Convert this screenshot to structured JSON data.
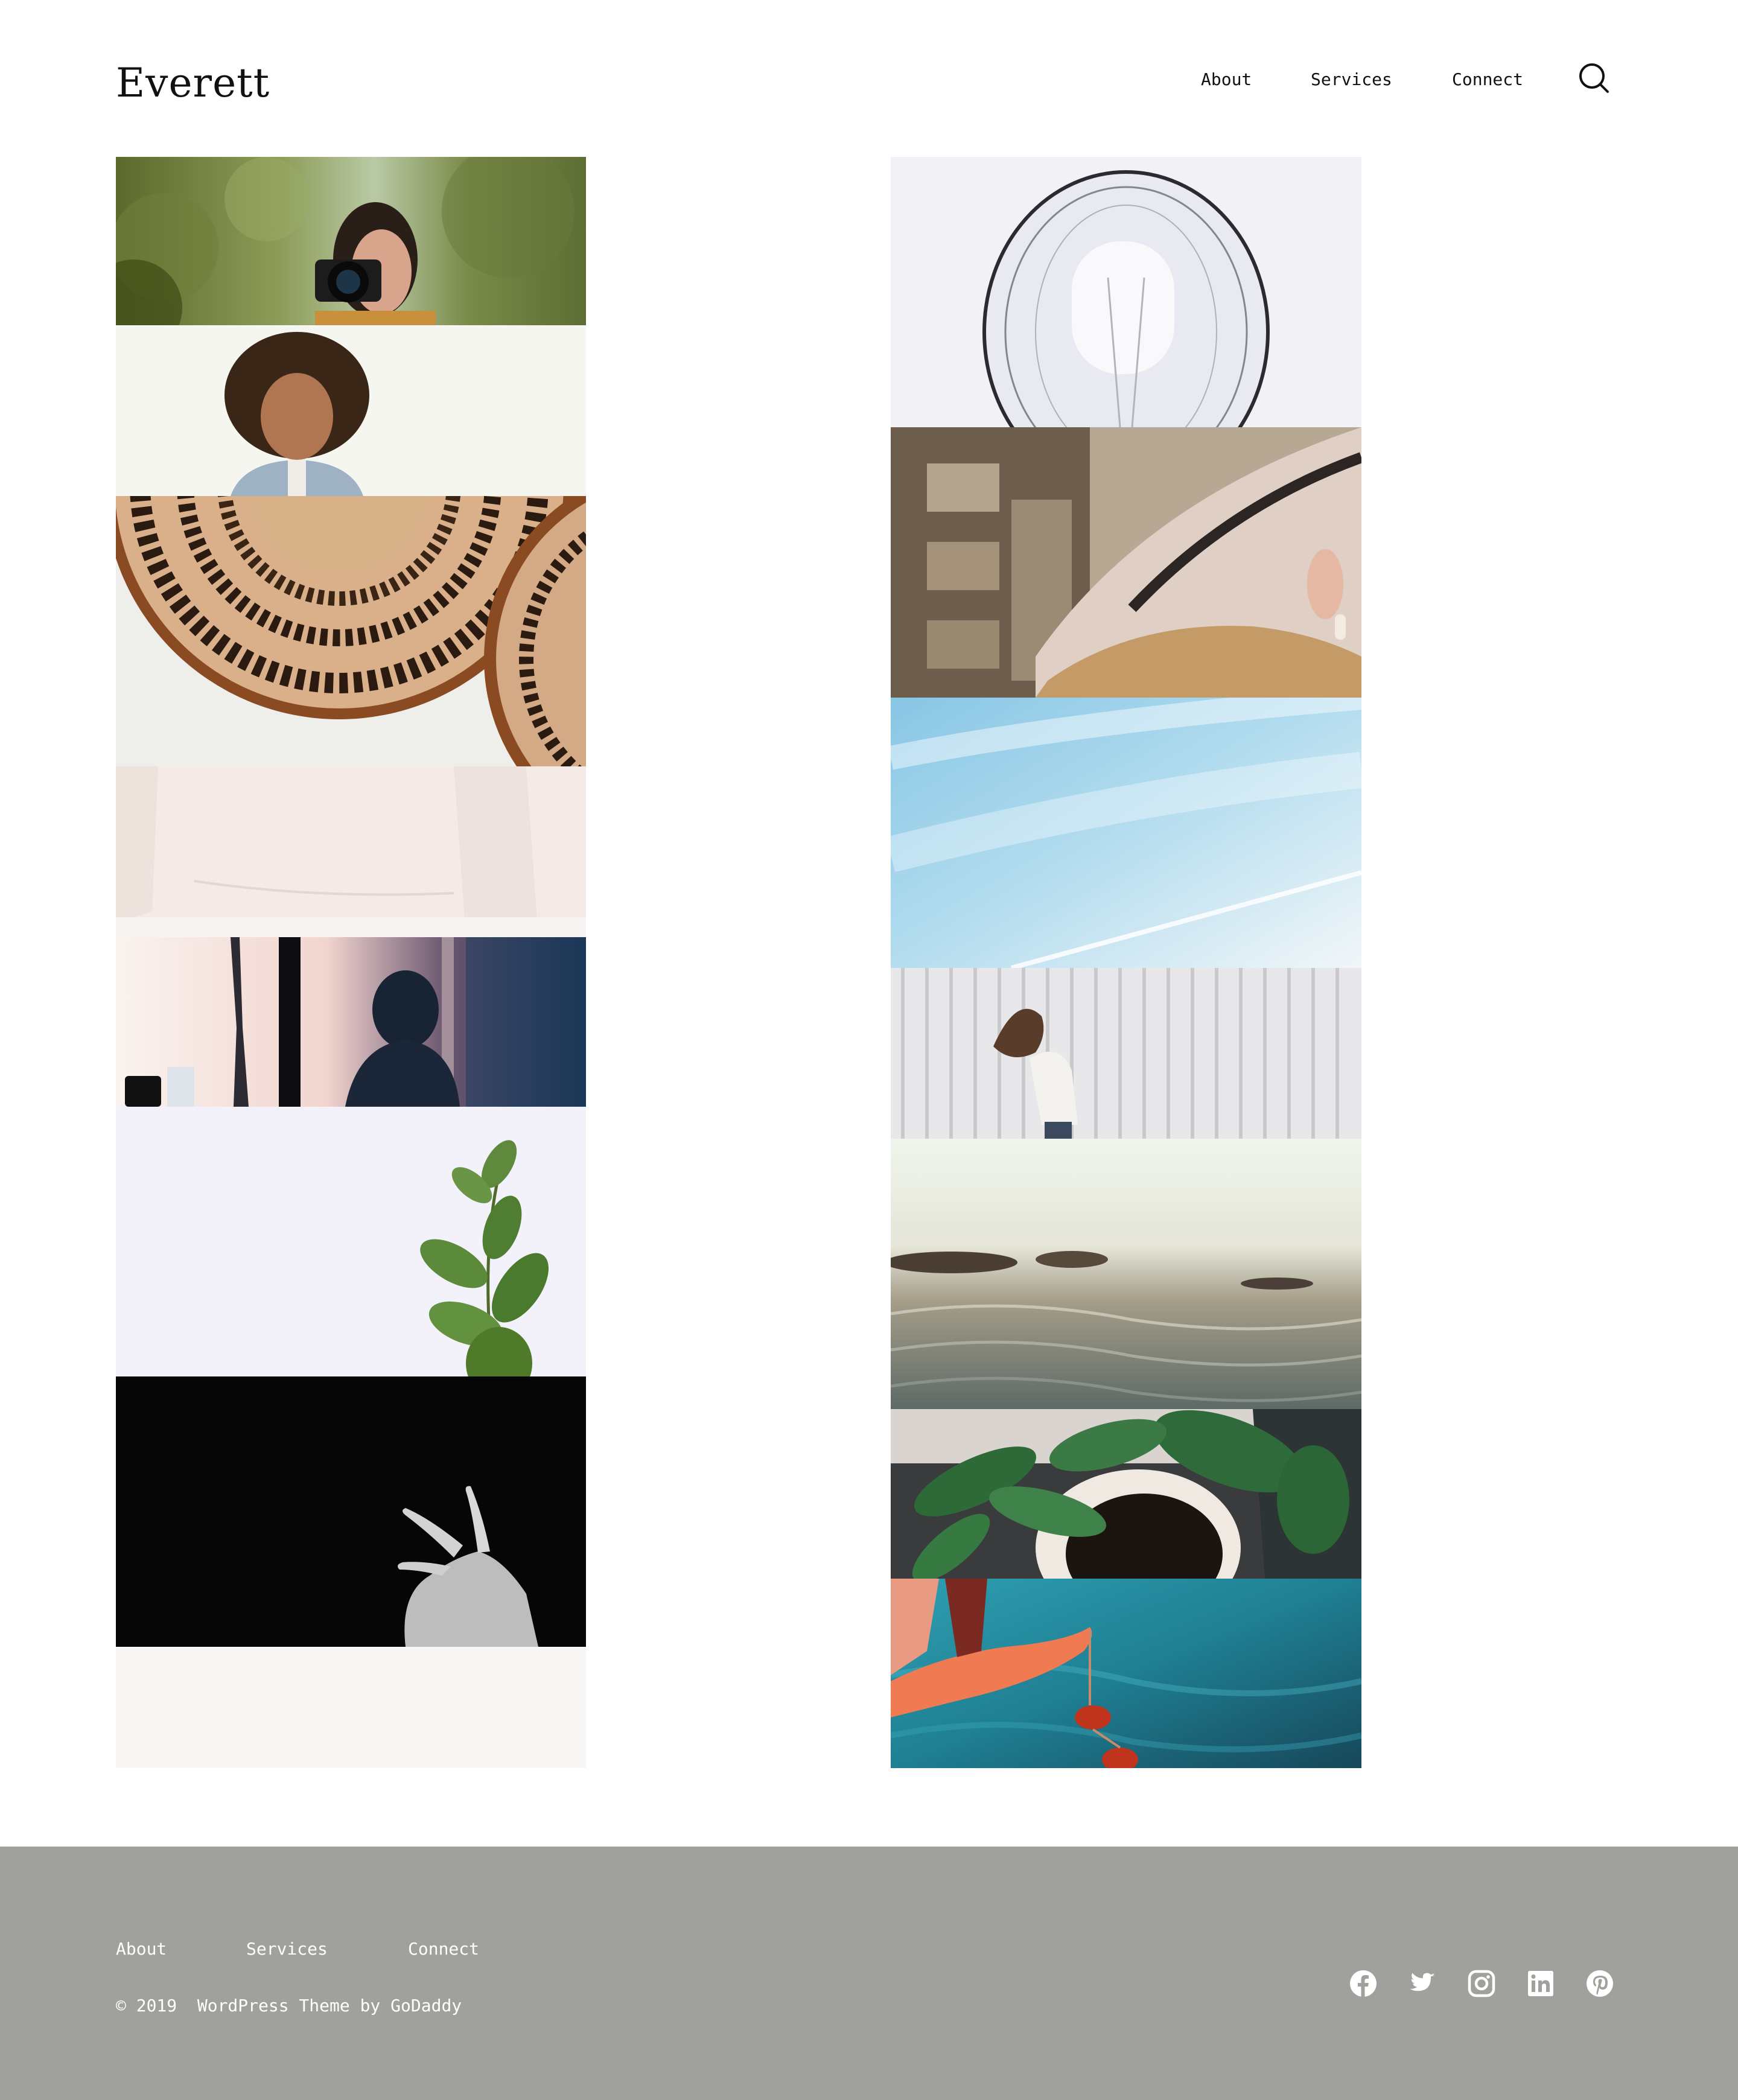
{
  "site": {
    "title": "Everett"
  },
  "nav": {
    "items": [
      {
        "label": "About"
      },
      {
        "label": "Services"
      },
      {
        "label": "Connect"
      }
    ],
    "search_icon": "search-icon"
  },
  "gallery": {
    "left": [
      "woman-with-camera",
      "smiling-child",
      "woven-baskets",
      "cream-sweater",
      "silhouette-by-window",
      "eucalyptus-branch",
      "hand-on-black",
      "blank-light"
    ],
    "right": [
      "glass-bubble",
      "woman-in-hat",
      "sky-with-contrail",
      "woman-flipping-hair",
      "sea-at-sunset",
      "leaves-and-coffee-cup",
      "hand-with-sunglasses"
    ]
  },
  "footer": {
    "links": [
      {
        "label": "About"
      },
      {
        "label": "Services"
      },
      {
        "label": "Connect"
      }
    ],
    "copyright": "© 2019  WordPress Theme by GoDaddy",
    "social_icons": [
      "facebook-icon",
      "twitter-icon",
      "instagram-icon",
      "linkedin-icon",
      "pinterest-icon"
    ],
    "background": "#a0a19c"
  }
}
